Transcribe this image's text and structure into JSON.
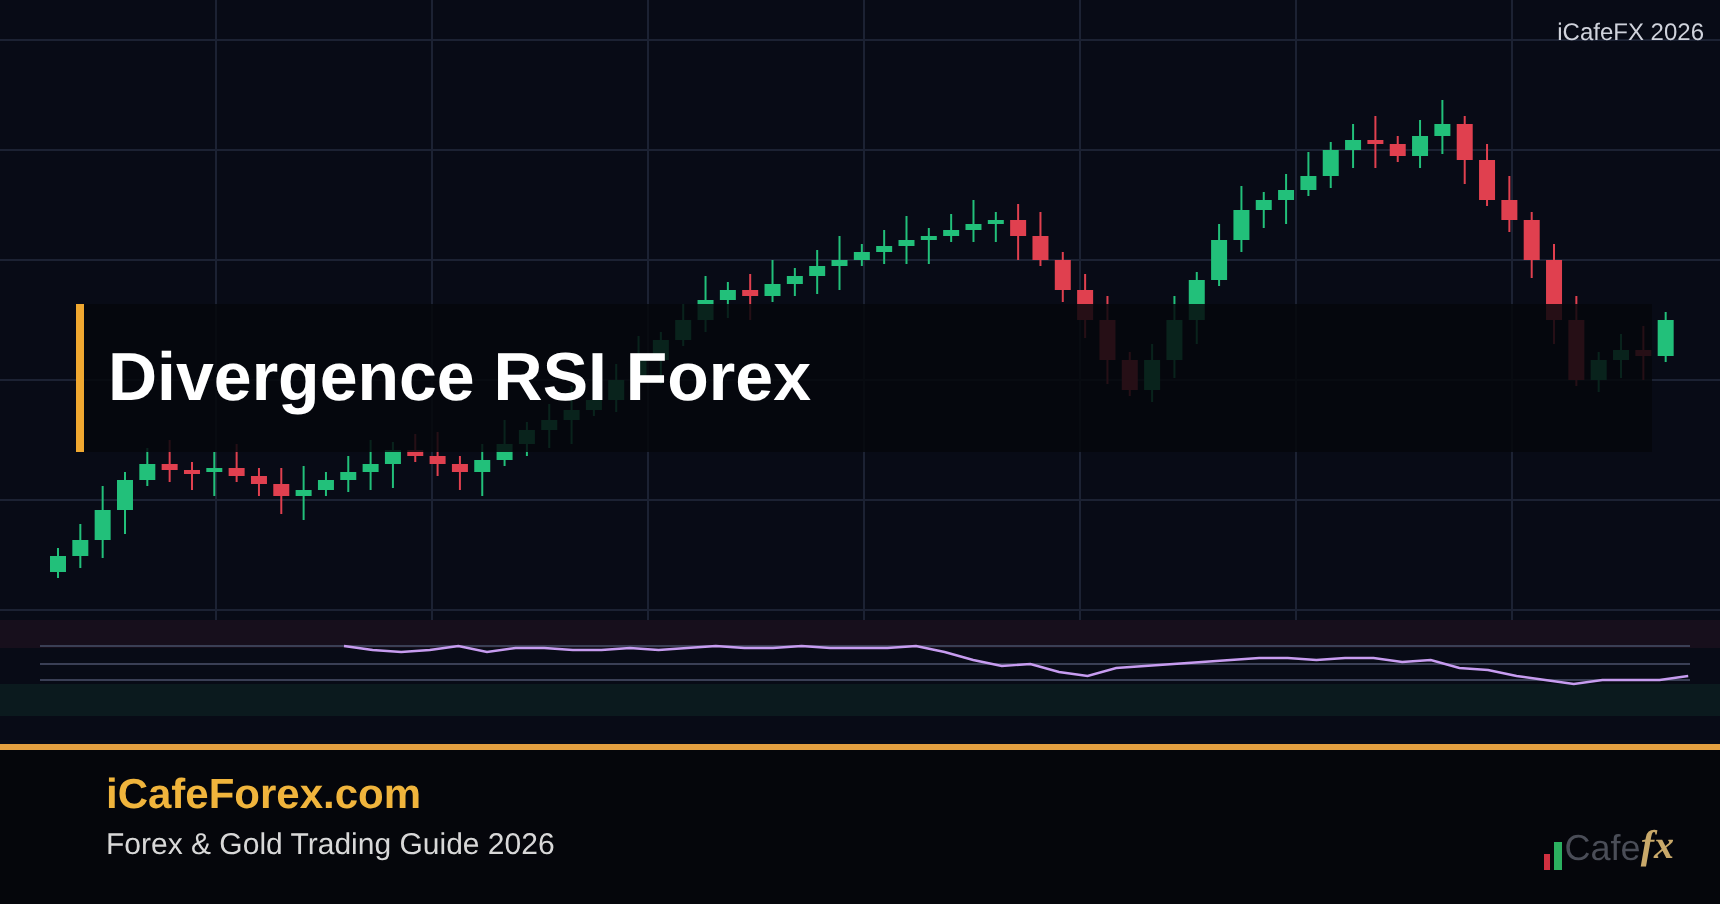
{
  "title": "Divergence RSI Forex",
  "badge": "iCafeFX 2026",
  "footer": {
    "site": "iCafeForex.com",
    "tagline": "Forex & Gold Trading Guide 2026"
  },
  "logo": {
    "text": "Cafe",
    "accent": "fx"
  }
}
